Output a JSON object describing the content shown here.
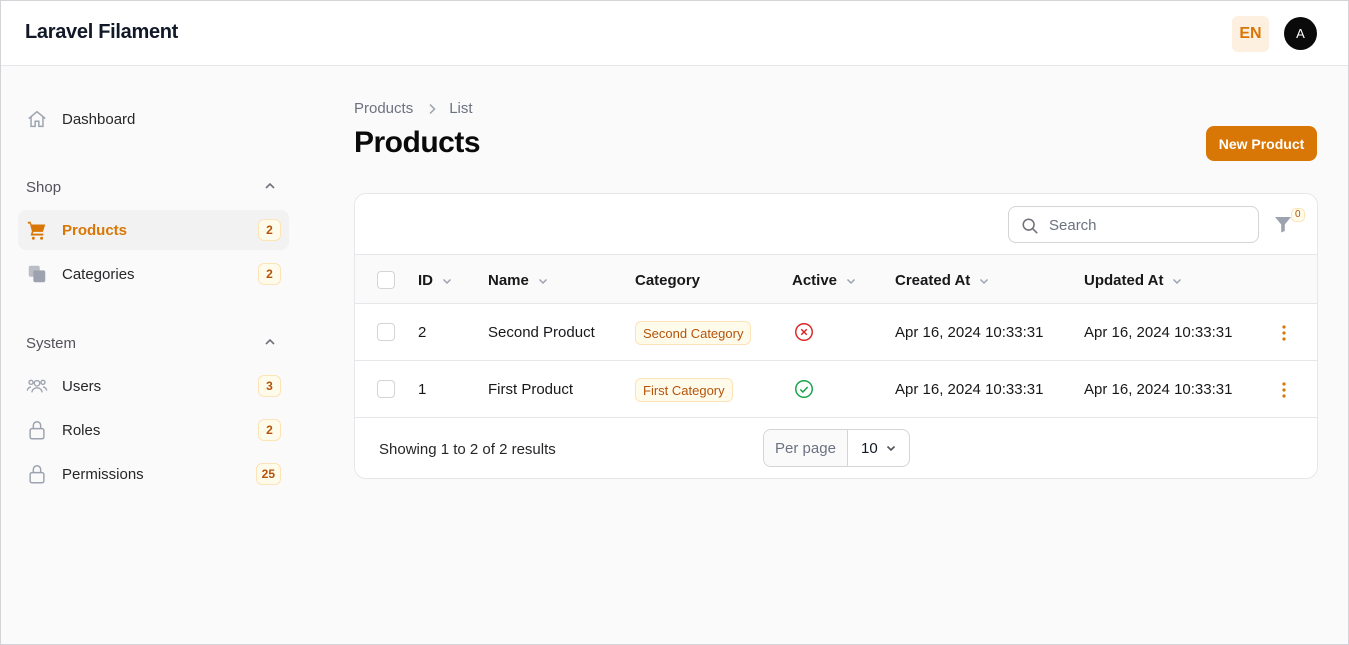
{
  "app": {
    "brand": "Laravel Filament",
    "language": "EN",
    "avatar_initial": "A"
  },
  "sidebar": {
    "dashboard": {
      "label": "Dashboard",
      "icon": "home-icon"
    },
    "groups": [
      {
        "label": "Shop",
        "items": [
          {
            "label": "Products",
            "count": "2",
            "icon": "shopping-cart-icon",
            "active": true
          },
          {
            "label": "Categories",
            "count": "2",
            "icon": "stack-icon",
            "active": false
          }
        ]
      },
      {
        "label": "System",
        "items": [
          {
            "label": "Users",
            "count": "3",
            "icon": "users-icon",
            "active": false
          },
          {
            "label": "Roles",
            "count": "2",
            "icon": "lock-icon",
            "active": false
          },
          {
            "label": "Permissions",
            "count": "25",
            "icon": "lock-icon",
            "active": false
          }
        ]
      }
    ]
  },
  "breadcrumb": [
    "Products",
    "List"
  ],
  "page": {
    "title": "Products",
    "new_button": "New Product"
  },
  "table": {
    "search_placeholder": "Search",
    "filter_count": "0",
    "columns": [
      "ID",
      "Name",
      "Category",
      "Active",
      "Created At",
      "Updated At"
    ],
    "rows": [
      {
        "id": "2",
        "name": "Second Product",
        "category": "Second Category",
        "active": false,
        "created_at": "Apr 16, 2024 10:33:31",
        "updated_at": "Apr 16, 2024 10:33:31"
      },
      {
        "id": "1",
        "name": "First Product",
        "category": "First Category",
        "active": true,
        "created_at": "Apr 16, 2024 10:33:31",
        "updated_at": "Apr 16, 2024 10:33:31"
      }
    ],
    "footer": {
      "summary": "Showing 1 to 2 of 2 results",
      "per_page_label": "Per page",
      "per_page_value": "10"
    }
  },
  "colors": {
    "accent": "#d97706",
    "success": "#16a34a",
    "danger": "#dc2626"
  }
}
